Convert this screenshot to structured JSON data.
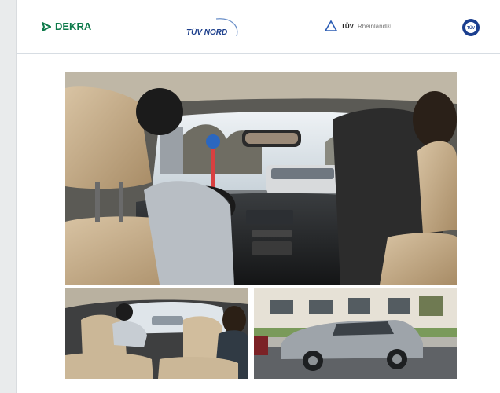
{
  "header": {
    "logos": {
      "dekra": "DEKRA",
      "tuv_nord": "TÜV NORD",
      "tuv_rheinland_bold": "TÜV",
      "tuv_rheinland_light": "Rheinland®",
      "tuv_seal": "TÜV"
    }
  },
  "icons": {
    "dekra": "dekra-arrow-icon",
    "rheinland": "triangle-icon",
    "seal": "tuv-seal-icon"
  },
  "photos": {
    "main": "driving-lesson-interior",
    "bottom_left": "driving-lesson-rear-seat",
    "bottom_right": "silver-suv-driving"
  },
  "colors": {
    "dekra_green": "#0d7a4a",
    "tuv_nord_blue": "#1d3f8c",
    "seal_blue": "#1b3f8f"
  }
}
